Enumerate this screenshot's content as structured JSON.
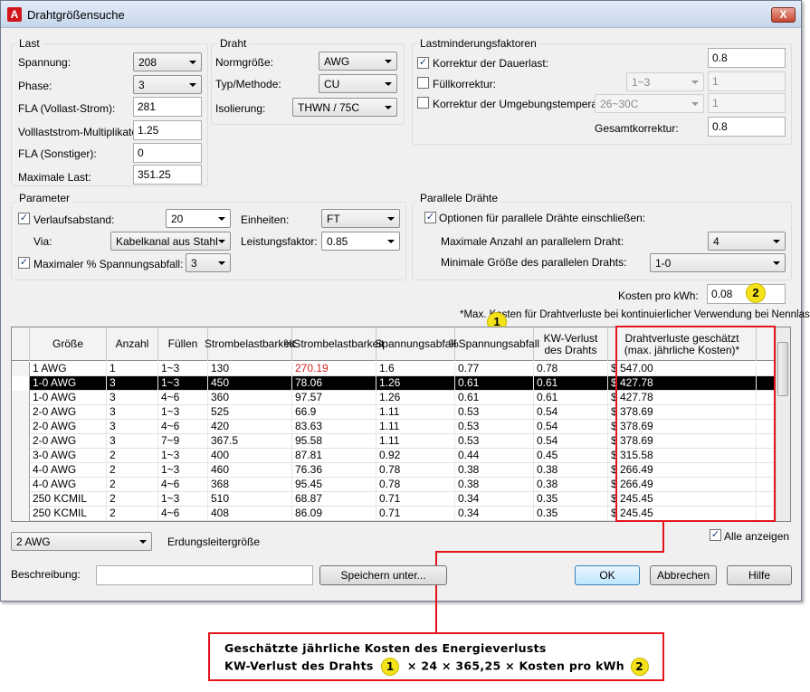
{
  "window": {
    "title": "Drahtgrößensuche",
    "app_icon": "A",
    "close_label": "X"
  },
  "last": {
    "group_label": "Last",
    "spannung_label": "Spannung:",
    "spannung_value": "208",
    "phase_label": "Phase:",
    "phase_value": "3",
    "fla_label": "FLA (Vollast-Strom):",
    "fla_value": "281",
    "mult_label": "Volllaststrom-Multiplikator:",
    "mult_value": "1.25",
    "fla_sonst_label": "FLA (Sonstiger):",
    "fla_sonst_value": "0",
    "maxlast_label": "Maximale Last:",
    "maxlast_value": "351.25"
  },
  "draht": {
    "group_label": "Draht",
    "norm_label": "Normgröße:",
    "norm_value": "AWG",
    "typ_label": "Typ/Methode:",
    "typ_value": "CU",
    "iso_label": "Isolierung:",
    "iso_value": "THWN / 75C"
  },
  "lastminderung": {
    "group_label": "Lastminderungsfaktoren",
    "dauerlast_label": "Korrektur der Dauerlast:",
    "dauerlast_checked": true,
    "dauerlast_value": "0.8",
    "fuell_label": "Füllkorrektur:",
    "fuell_checked": false,
    "fuell_dd": "1~3",
    "fuell_value": "1",
    "umgeb_label": "Korrektur der Umgebungstemperatur:",
    "umgeb_checked": false,
    "umgeb_dd": "26~30C",
    "umgeb_value": "1",
    "gesamt_label": "Gesamtkorrektur:",
    "gesamt_value": "0.8"
  },
  "parameter": {
    "group_label": "Parameter",
    "verlauf_label": "Verlaufsabstand:",
    "verlauf_checked": true,
    "verlauf_value": "20",
    "einheiten_label": "Einheiten:",
    "einheiten_value": "FT",
    "via_label": "Via:",
    "via_value": "Kabelkanal aus Stahl",
    "lf_label": "Leistungsfaktor:",
    "lf_value": "0.85",
    "maxabfall_label": "Maximaler % Spannungsabfall:",
    "maxabfall_checked": true,
    "maxabfall_value": "3"
  },
  "parallel": {
    "group_label": "Parallele Drähte",
    "optionen_label": "Optionen für parallele Drähte einschließen:",
    "optionen_checked": true,
    "maxanzahl_label": "Maximale Anzahl an parallelem Draht:",
    "maxanzahl_value": "4",
    "mingroesse_label": "Minimale Größe des parallelen Drahts:",
    "mingroesse_value": "1-0"
  },
  "kosten": {
    "label": "Kosten pro kWh:",
    "value": "0.08"
  },
  "note": "*Max. Kosten für Drahtverluste bei kontinuierlicher Verwendung bei Nennlast",
  "table": {
    "headers": [
      "Größe",
      "Anzahl",
      "Füllen",
      "Strombelastbarkeit",
      "%Strombelastbarkeit",
      "Spannungsabfall",
      "%Spannungsabfall",
      "KW-Verlust des Drahts",
      "Drahtverluste geschätzt (max. jährliche Kosten)*"
    ],
    "rows": [
      [
        "1 AWG",
        "1",
        "1~3",
        "130",
        "270.19",
        "1.6",
        "0.77",
        "0.78",
        "$ 547.00"
      ],
      [
        "1-0 AWG",
        "3",
        "1~3",
        "450",
        "78.06",
        "1.26",
        "0.61",
        "0.61",
        "$ 427.78"
      ],
      [
        "1-0 AWG",
        "3",
        "4~6",
        "360",
        "97.57",
        "1.26",
        "0.61",
        "0.61",
        "$ 427.78"
      ],
      [
        "2-0 AWG",
        "3",
        "1~3",
        "525",
        "66.9",
        "1.11",
        "0.53",
        "0.54",
        "$ 378.69"
      ],
      [
        "2-0 AWG",
        "3",
        "4~6",
        "420",
        "83.63",
        "1.11",
        "0.53",
        "0.54",
        "$ 378.69"
      ],
      [
        "2-0 AWG",
        "3",
        "7~9",
        "367.5",
        "95.58",
        "1.11",
        "0.53",
        "0.54",
        "$ 378.69"
      ],
      [
        "3-0 AWG",
        "2",
        "1~3",
        "400",
        "87.81",
        "0.92",
        "0.44",
        "0.45",
        "$ 315.58"
      ],
      [
        "4-0 AWG",
        "2",
        "1~3",
        "460",
        "76.36",
        "0.78",
        "0.38",
        "0.38",
        "$ 266.49"
      ],
      [
        "4-0 AWG",
        "2",
        "4~6",
        "368",
        "95.45",
        "0.78",
        "0.38",
        "0.38",
        "$ 266.49"
      ],
      [
        "250 KCMIL",
        "2",
        "1~3",
        "510",
        "68.87",
        "0.71",
        "0.34",
        "0.35",
        "$ 245.45"
      ],
      [
        "250 KCMIL",
        "2",
        "4~6",
        "408",
        "86.09",
        "0.71",
        "0.34",
        "0.35",
        "$ 245.45"
      ]
    ],
    "selected_row": 1,
    "highlight_row": 0,
    "highlight_col": 4,
    "highlight_color": "#d01f1f"
  },
  "footer": {
    "erdung_value": "2 AWG",
    "erdung_label": "Erdungsleitergröße",
    "alle_label": "Alle anzeigen",
    "alle_checked": true,
    "beschreibung_label": "Beschreibung:",
    "beschreibung_value": "",
    "speichern_label": "Speichern unter...",
    "ok_label": "OK",
    "abbrechen_label": "Abbrechen",
    "hilfe_label": "Hilfe"
  },
  "annotations": {
    "badge1": "1",
    "badge2": "2",
    "callout_line1": "Geschätzte jährliche Kosten des Energieverlusts",
    "callout_line2a": "KW-Verlust des Drahts",
    "callout_line2b": "× 24 × 365,25 × Kosten pro kWh",
    "accent_color": "#e3141c",
    "badge_color": "#f4e31a"
  }
}
